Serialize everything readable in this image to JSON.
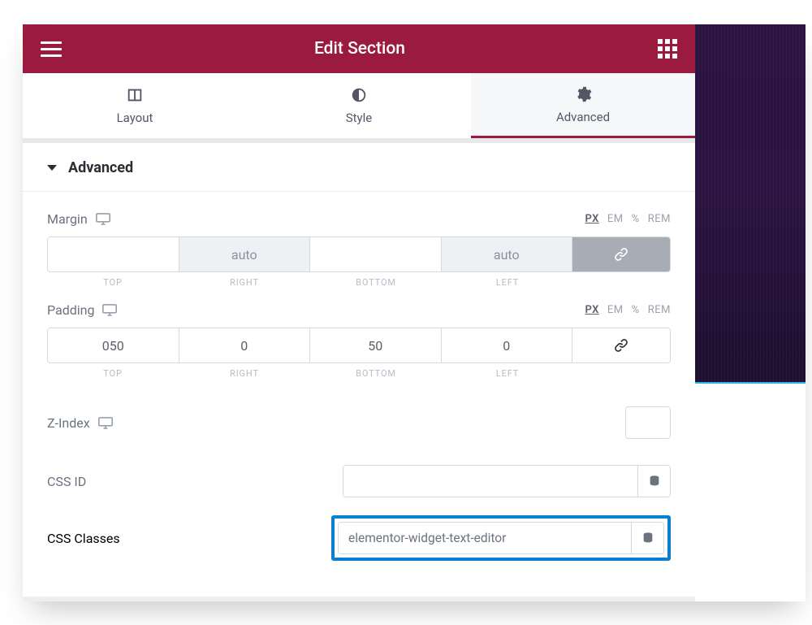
{
  "header": {
    "title": "Edit Section"
  },
  "tabs": {
    "layout": "Layout",
    "style": "Style",
    "advanced": "Advanced"
  },
  "section": {
    "title": "Advanced"
  },
  "units": {
    "px": "PX",
    "em": "EM",
    "pct": "%",
    "rem": "REM"
  },
  "dimLabels": {
    "top": "TOP",
    "right": "RIGHT",
    "bottom": "BOTTOM",
    "left": "LEFT"
  },
  "margin": {
    "label": "Margin",
    "top": "",
    "right": "auto",
    "bottom": "",
    "left": "auto"
  },
  "padding": {
    "label": "Padding",
    "top": "050",
    "right": "0",
    "bottom": "50",
    "left": "0"
  },
  "zindex": {
    "label": "Z-Index",
    "value": ""
  },
  "cssId": {
    "label": "CSS ID",
    "value": ""
  },
  "cssClasses": {
    "label": "CSS Classes",
    "value": "elementor-widget-text-editor"
  }
}
